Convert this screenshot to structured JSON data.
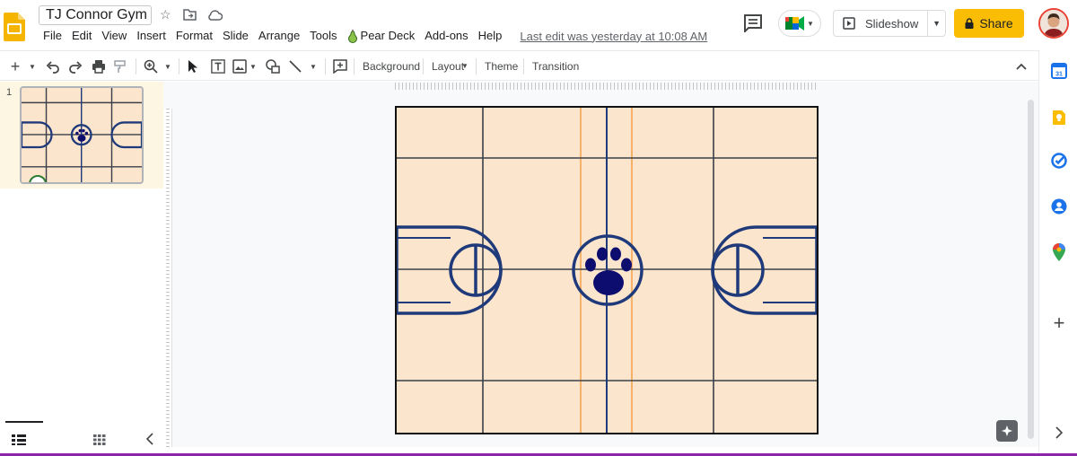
{
  "app": {
    "doc_title": "TJ Connor Gym",
    "last_edit": "Last edit was yesterday at 10:08 AM"
  },
  "menu": {
    "items": [
      "File",
      "Edit",
      "View",
      "Insert",
      "Format",
      "Slide",
      "Arrange",
      "Tools",
      "Pear Deck",
      "Add-ons",
      "Help"
    ]
  },
  "header": {
    "slideshow_label": "Slideshow",
    "share_label": "Share"
  },
  "toolbar": {
    "background_label": "Background",
    "layout_label": "Layout",
    "theme_label": "Theme",
    "transition_label": "Transition"
  },
  "filmstrip": {
    "slide_number": "1"
  },
  "colors": {
    "court_fill": "#fce5cd",
    "court_lines": "#1f3a7a",
    "paw": "#0d0d70",
    "accent_yellow": "#fbbc04",
    "slides_logo": "#f4b400"
  },
  "icons": {
    "star": "star-icon",
    "move_to_folder": "move-to-folder-icon",
    "cloud_status": "cloud-saved-icon",
    "comments": "comment-history-icon",
    "meet": "google-meet-icon",
    "slideshow": "play-icon",
    "share_lock": "lock-icon",
    "calendar": "calendar-icon",
    "keep": "keep-icon",
    "tasks": "tasks-icon",
    "contacts": "contacts-icon",
    "maps": "maps-icon",
    "add": "plus-icon"
  }
}
